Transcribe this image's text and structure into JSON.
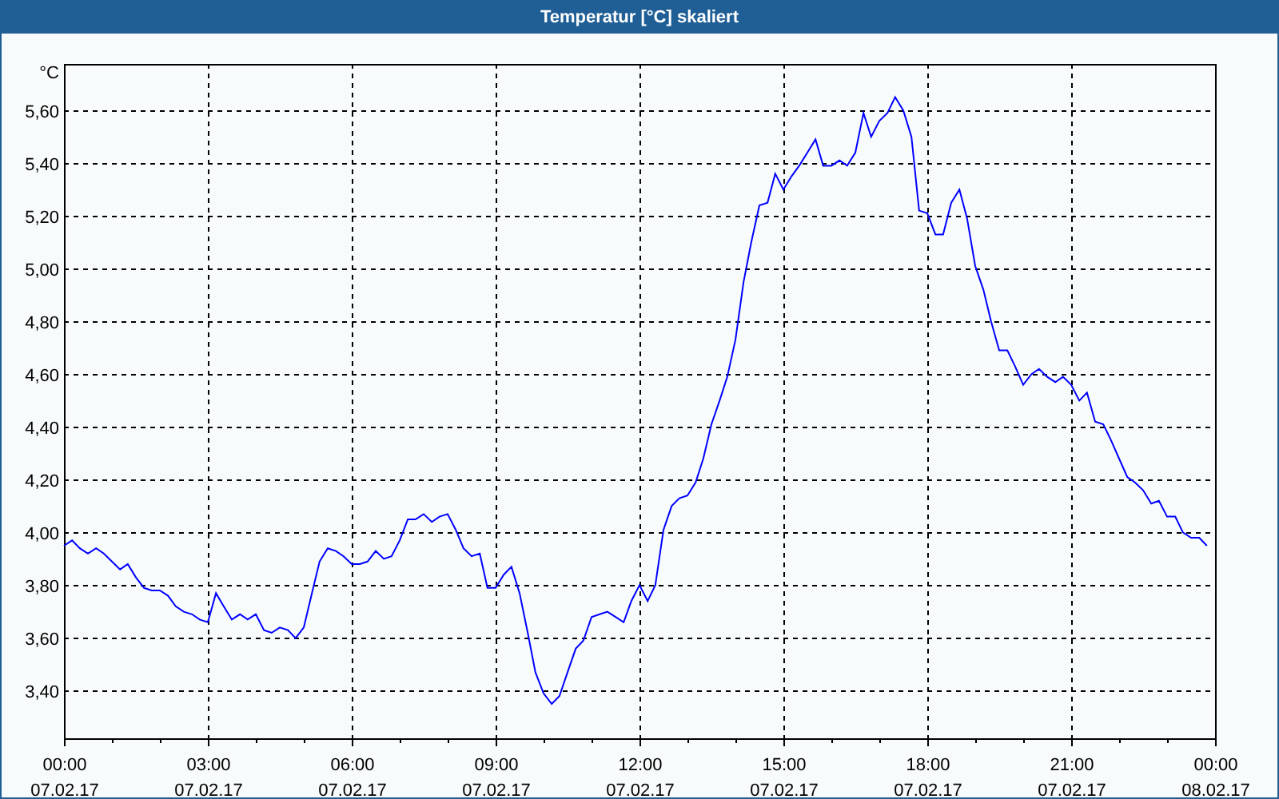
{
  "window": {
    "title": "Temperatur [°C] skaliert"
  },
  "chart": {
    "chart_data": {
      "type": "line",
      "ylabel": "°C",
      "xlim": [
        0,
        24
      ],
      "ylim": [
        3.22,
        5.776
      ],
      "grid": true,
      "xticks": [
        {
          "value": 0,
          "label": "00:00"
        },
        {
          "value": 3,
          "label": "03:00"
        },
        {
          "value": 6,
          "label": "06:00"
        },
        {
          "value": 9,
          "label": "09:00"
        },
        {
          "value": 12,
          "label": "12:00"
        },
        {
          "value": 15,
          "label": "15:00"
        },
        {
          "value": 18,
          "label": "18:00"
        },
        {
          "value": 21,
          "label": "21:00"
        },
        {
          "value": 24,
          "label": "00:00"
        }
      ],
      "yticks": [
        {
          "value": 3.4,
          "label": "3,40"
        },
        {
          "value": 3.6,
          "label": "3,60"
        },
        {
          "value": 3.8,
          "label": "3,80"
        },
        {
          "value": 4.0,
          "label": "4,00"
        },
        {
          "value": 4.2,
          "label": "4,20"
        },
        {
          "value": 4.4,
          "label": "4,40"
        },
        {
          "value": 4.6,
          "label": "4,60"
        },
        {
          "value": 4.8,
          "label": "4,80"
        },
        {
          "value": 5.0,
          "label": "5,00"
        },
        {
          "value": 5.2,
          "label": "5,20"
        },
        {
          "value": 5.4,
          "label": "5,40"
        },
        {
          "value": 5.6,
          "label": "5,60"
        }
      ],
      "x": [
        0,
        0.17,
        0.33,
        0.5,
        0.67,
        0.83,
        1,
        1.17,
        1.33,
        1.5,
        1.67,
        1.83,
        2,
        2.17,
        2.33,
        2.5,
        2.67,
        2.83,
        3,
        3.17,
        3.33,
        3.5,
        3.67,
        3.83,
        4,
        4.17,
        4.33,
        4.5,
        4.67,
        4.83,
        5,
        5.17,
        5.33,
        5.5,
        5.67,
        5.83,
        6,
        6.17,
        6.33,
        6.5,
        6.67,
        6.83,
        7,
        7.17,
        7.33,
        7.5,
        7.67,
        7.83,
        8,
        8.17,
        8.33,
        8.5,
        8.67,
        8.83,
        9,
        9.17,
        9.33,
        9.5,
        9.67,
        9.83,
        10,
        10.17,
        10.33,
        10.5,
        10.67,
        10.83,
        11,
        11.17,
        11.33,
        11.5,
        11.67,
        11.83,
        12,
        12.17,
        12.33,
        12.5,
        12.67,
        12.83,
        13,
        13.17,
        13.33,
        13.5,
        13.67,
        13.83,
        14,
        14.17,
        14.33,
        14.5,
        14.67,
        14.83,
        15,
        15.17,
        15.33,
        15.5,
        15.67,
        15.83,
        16,
        16.17,
        16.33,
        16.5,
        16.67,
        16.83,
        17,
        17.17,
        17.33,
        17.5,
        17.67,
        17.83,
        18,
        18.17,
        18.33,
        18.5,
        18.67,
        18.83,
        19,
        19.17,
        19.33,
        19.5,
        19.67,
        19.83,
        20,
        20.17,
        20.33,
        20.5,
        20.67,
        20.83,
        21,
        21.17,
        21.33,
        21.5,
        21.67,
        21.83,
        22,
        22.17,
        22.33,
        22.5,
        22.67,
        22.83,
        23,
        23.17,
        23.33,
        23.5,
        23.67,
        23.83
      ],
      "series": [
        {
          "color": "#0000ff",
          "values": [
            3.95,
            3.97,
            3.94,
            3.92,
            3.94,
            3.92,
            3.89,
            3.86,
            3.88,
            3.83,
            3.79,
            3.78,
            3.78,
            3.76,
            3.72,
            3.7,
            3.69,
            3.67,
            3.66,
            3.77,
            3.72,
            3.67,
            3.69,
            3.67,
            3.69,
            3.63,
            3.62,
            3.64,
            3.63,
            3.6,
            3.64,
            3.77,
            3.89,
            3.94,
            3.93,
            3.91,
            3.88,
            3.88,
            3.89,
            3.93,
            3.9,
            3.91,
            3.97,
            4.05,
            4.05,
            4.07,
            4.04,
            4.06,
            4.07,
            4.01,
            3.94,
            3.91,
            3.92,
            3.79,
            3.79,
            3.84,
            3.87,
            3.77,
            3.62,
            3.47,
            3.39,
            3.35,
            3.38,
            3.47,
            3.56,
            3.59,
            3.68,
            3.69,
            3.7,
            3.68,
            3.66,
            3.74,
            3.8,
            3.74,
            3.8,
            4.01,
            4.1,
            4.13,
            4.14,
            4.19,
            4.28,
            4.41,
            4.5,
            4.59,
            4.73,
            4.95,
            5.1,
            5.24,
            5.25,
            5.36,
            5.3,
            5.35,
            5.39,
            5.44,
            5.49,
            5.39,
            5.39,
            5.41,
            5.39,
            5.44,
            5.59,
            5.5,
            5.56,
            5.59,
            5.65,
            5.6,
            5.5,
            5.22,
            5.21,
            5.13,
            5.13,
            5.25,
            5.3,
            5.19,
            5.01,
            4.92,
            4.8,
            4.69,
            4.69,
            4.63,
            4.56,
            4.6,
            4.62,
            4.59,
            4.57,
            4.59,
            4.56,
            4.5,
            4.53,
            4.42,
            4.41,
            4.35,
            4.28,
            4.21,
            4.19,
            4.16,
            4.11,
            4.12,
            4.06,
            4.06,
            4.0,
            3.98,
            3.98,
            3.95
          ]
        }
      ]
    },
    "x_date_labels": [
      "07.02.17",
      "07.02.17",
      "07.02.17",
      "07.02.17",
      "07.02.17",
      "07.02.17",
      "07.02.17",
      "07.02.17",
      "08.02.17"
    ]
  }
}
